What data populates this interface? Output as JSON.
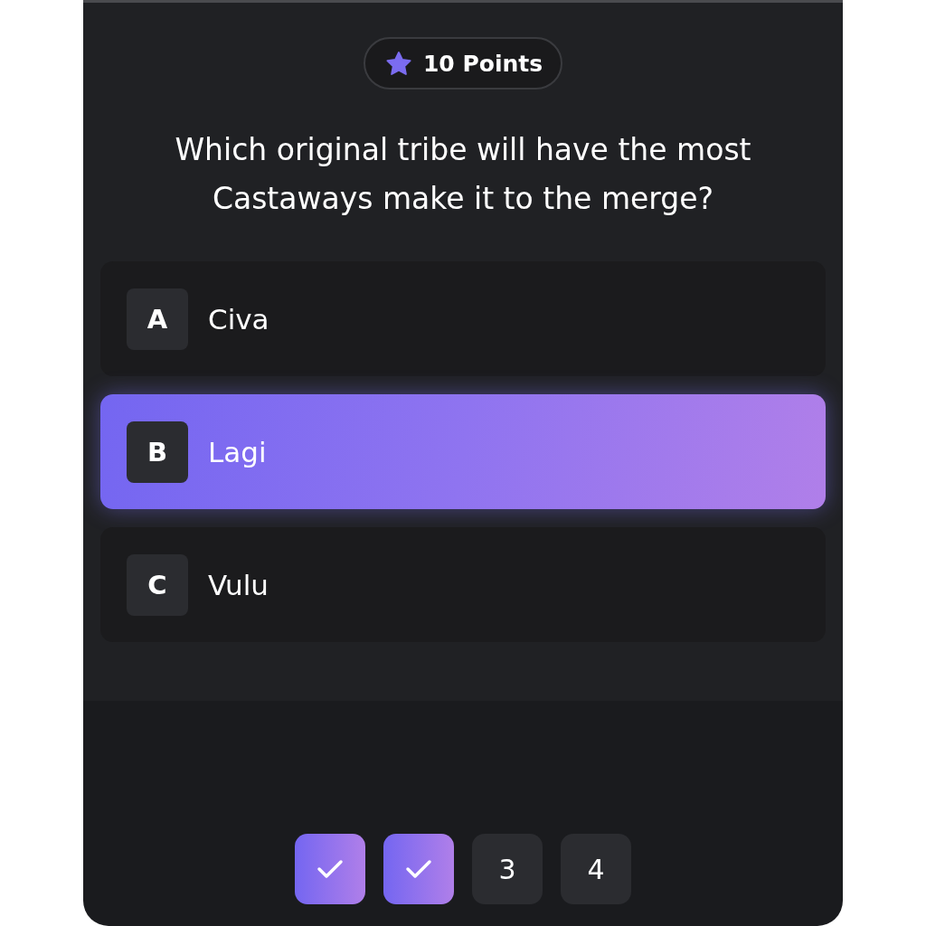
{
  "points_badge": {
    "label": "10 Points"
  },
  "question": "Which original tribe will have the most Castaways make it to the merge?",
  "options": [
    {
      "letter": "A",
      "label": "Civa",
      "selected": false
    },
    {
      "letter": "B",
      "label": "Lagi",
      "selected": true
    },
    {
      "letter": "C",
      "label": "Vulu",
      "selected": false
    }
  ],
  "steps": [
    {
      "completed": true
    },
    {
      "completed": true
    },
    {
      "label": "3",
      "completed": false
    },
    {
      "label": "4",
      "completed": false
    }
  ]
}
